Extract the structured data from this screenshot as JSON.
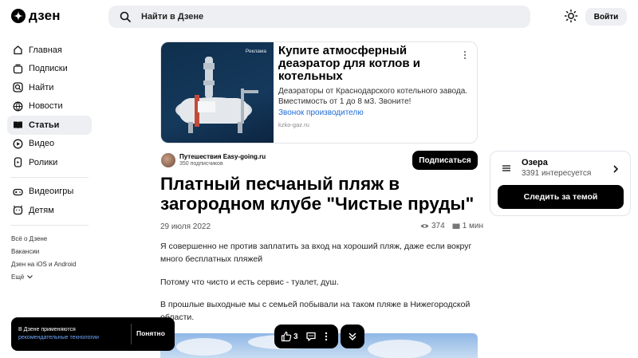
{
  "header": {
    "logo_text": "дзен",
    "search_placeholder": "Найти в Дзене",
    "login_label": "Войти"
  },
  "sidebar": {
    "items": [
      {
        "label": "Главная",
        "icon": "home-icon"
      },
      {
        "label": "Подписки",
        "icon": "subscriptions-icon"
      },
      {
        "label": "Найти",
        "icon": "search-icon"
      },
      {
        "label": "Новости",
        "icon": "news-icon"
      },
      {
        "label": "Статьи",
        "icon": "articles-icon",
        "active": true
      },
      {
        "label": "Видео",
        "icon": "video-icon"
      },
      {
        "label": "Ролики",
        "icon": "shorts-icon"
      }
    ],
    "items2": [
      {
        "label": "Видеоигры",
        "icon": "gamepad-icon"
      },
      {
        "label": "Детям",
        "icon": "kids-icon"
      }
    ],
    "links": [
      "Всё о Дзене",
      "Вакансии",
      "Дзен на iOS и Android",
      "Ещё"
    ]
  },
  "ad": {
    "tag": "Реклама",
    "title": "Купите атмосферный деаэратор для котлов и котельных",
    "text": "Деаэраторы от Краснодарского котельного завода. Вместимость от 1 до 8 м3. Звоните!",
    "link": "Звонок производителю",
    "domain": "kzko-gaz.ru"
  },
  "channel": {
    "name": "Путешествия Easy-going.ru",
    "subscribers": "350 подписчиков",
    "subscribe_label": "Подписаться"
  },
  "article": {
    "title": "Платный песчаный пляж в загородном клубе \"Чистые пруды\"",
    "date": "29 июля 2022",
    "views": "374",
    "read_time": "1 мин",
    "paragraphs": [
      "Я совершенно не против заплатить за вход на хороший пляж, даже если вокруг много бесплатных пляжей",
      "Потому что чисто и есть сервис - туалет, душ.",
      "В прошлые выходные мы с семьей побывали на таком пляже в Нижегородской области."
    ]
  },
  "topic": {
    "name": "Озера",
    "count": "3391 интересуется",
    "follow_label": "Следить за темой"
  },
  "cookie": {
    "line1": "В Дзене применяются",
    "link": "рекомендательные технологии",
    "ok_label": "Понятно"
  },
  "actions": {
    "likes": "3"
  }
}
